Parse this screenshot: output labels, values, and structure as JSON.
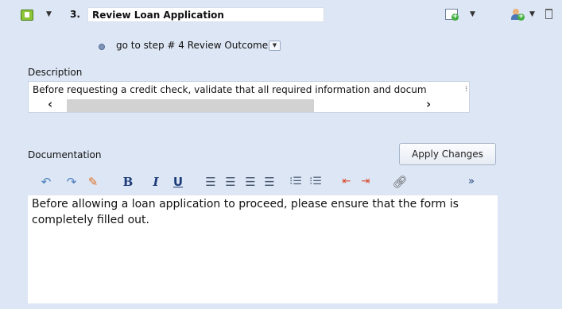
{
  "step": {
    "number": "3.",
    "title": "Review Loan Application"
  },
  "goto": {
    "text": "go to step # 4  Review Outcome"
  },
  "description": {
    "label": "Description",
    "value": "Before requesting a credit check, validate that all required information and docum"
  },
  "documentation": {
    "label": "Documentation",
    "apply_label": "Apply Changes",
    "content": "Before allowing a loan application to proceed, please ensure that the form is completely filled out."
  },
  "toolbar": {
    "bold": "B",
    "italic": "I",
    "underline": "U",
    "more": "»"
  },
  "colors": {
    "panel_bg": "#dde6f4",
    "step_icon": "#8cc43a",
    "indent_red": "#d9472b",
    "link_orange": "#e46b1f"
  }
}
